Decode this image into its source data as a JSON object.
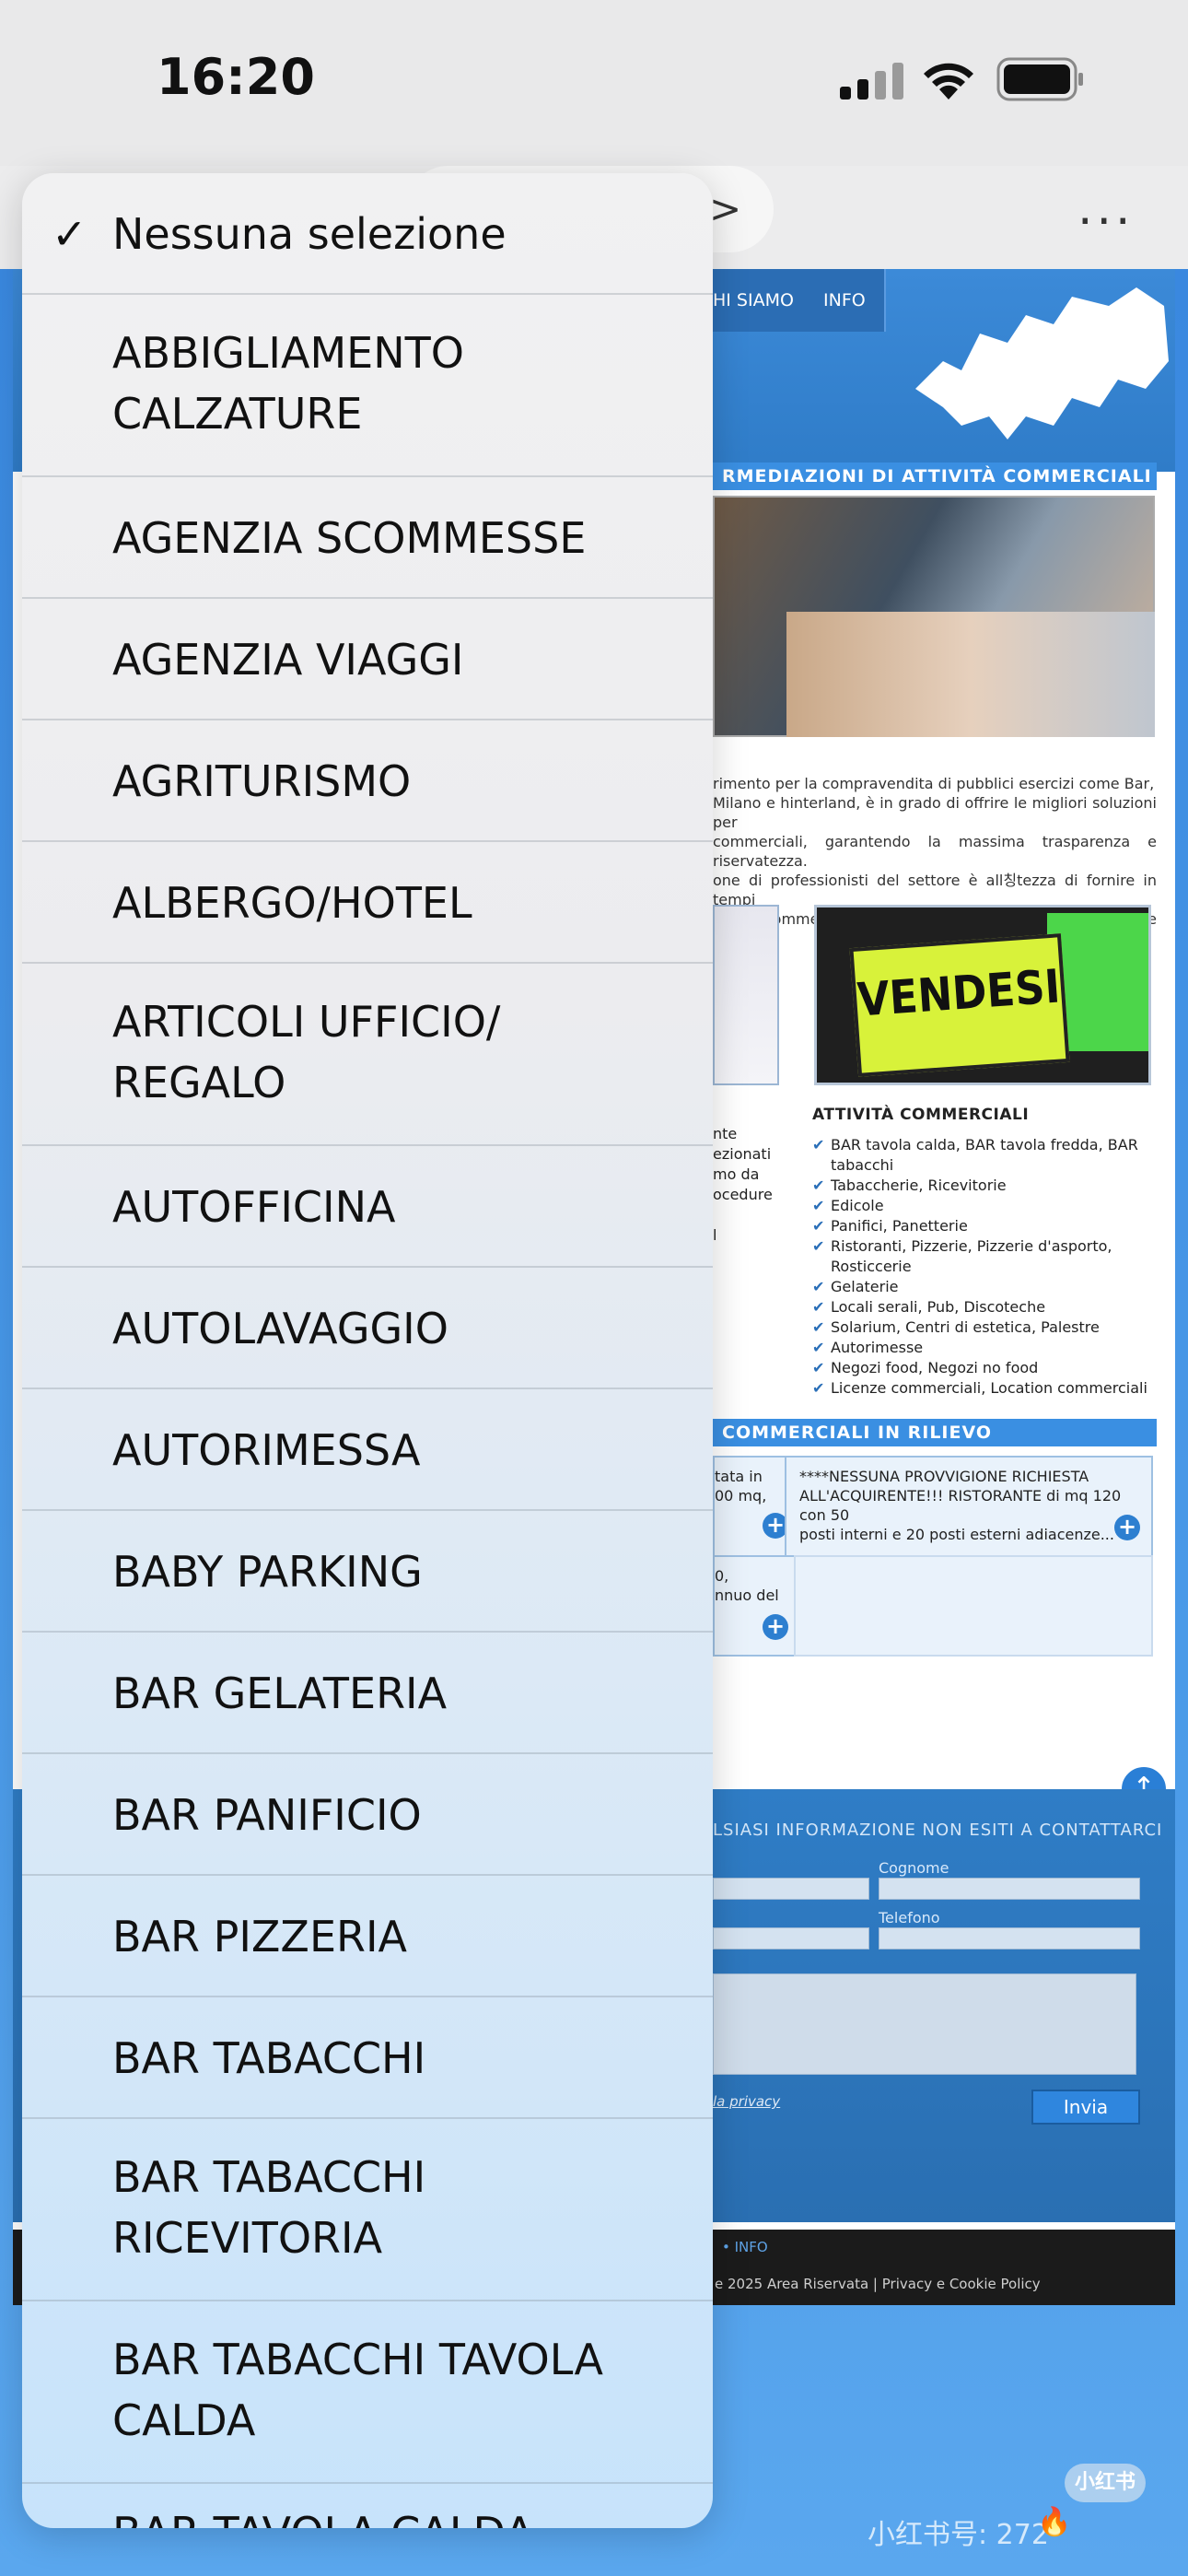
{
  "status_bar": {
    "time": "16:20"
  },
  "browser": {
    "url_chevron": ">",
    "more": "..."
  },
  "site": {
    "nav": [
      "HI SIAMO",
      "INFO"
    ],
    "section_title": "RMEDIAZIONI DI ATTIVITÀ COMMERCIALI",
    "intro_lines": [
      "rimento per la compravendita di pubblici esercizi come Bar,",
      "Milano e hinterland, è in grado di offrire le migliori soluzioni per",
      "commerciali, garantendo la massima trasparenza e riservatezza.",
      "one di professionisti del settore è all칭tezza di fornire in tempi",
      "ttività commerciali nella più totale sicurezza, chiarezza e privacy"
    ],
    "vendesi_sign": "VENDESI",
    "list_title": "ATTIVITÀ COMMERCIALI",
    "activities": [
      "BAR tavola calda, BAR tavola fredda, BAR tabacchi",
      "Tabaccherie, Ricevitorie",
      "Edicole",
      "Panifici, Panetterie",
      "Ristoranti, Pizzerie, Pizzerie d'asporto, Rosticcerie",
      "Gelaterie",
      "Locali serali, Pub, Discoteche",
      "Solarium, Centri di estetica, Palestre",
      "Autorimesse",
      "Negozi food, Negozi no food",
      "Licenze commerciali, Location commerciali"
    ],
    "left_fragments": [
      "nte",
      "ezionati",
      "mo da",
      "ocedure",
      "l"
    ],
    "featured_title": "COMMERCIALI IN RILIEVO",
    "featured_card_1": [
      "****NESSUNA PROVVIGIONE RICHIESTA",
      "ALL'ACQUIRENTE!!! RISTORANTE di mq 120 con 50",
      "posti interni e 20 posti esterni adiacenze..."
    ],
    "featured_left_1": [
      "tata in",
      "00 mq,"
    ],
    "featured_left_2": [
      "0,",
      "nnuo del"
    ],
    "contact_title": "LSIASI INFORMAZIONE NON ESITI A CONTATTARCI",
    "label_cognome": "Cognome",
    "label_telefono": "Telefono",
    "privacy_fragment": "la privacy",
    "send_button": "Invia",
    "footer_info": "• INFO",
    "footer_line": "e 2025     Area Riservata | Privacy e Cookie Policy"
  },
  "dropdown": {
    "selected_index": 0,
    "options": [
      "Nessuna selezione",
      "ABBIGLIAMENTO CALZATURE",
      "AGENZIA SCOMMESSE",
      "AGENZIA VIAGGI",
      "AGRITURISMO",
      "ALBERGO/HOTEL",
      "ARTICOLI UFFICIO/ REGALO",
      "AUTOFFICINA",
      "AUTOLAVAGGIO",
      "AUTORIMESSA",
      "BABY PARKING",
      "BAR GELATERIA",
      "BAR PANIFICIO",
      "BAR PIZZERIA",
      "BAR TABACCHI",
      "BAR TABACCHI RICEVITORIA",
      "BAR TABACCHI TAVOLA CALDA",
      "BAR TAVOLA CALDA"
    ],
    "option_lines": [
      [
        "Nessuna selezione"
      ],
      [
        "ABBIGLIAMENTO",
        "CALZATURE"
      ],
      [
        "AGENZIA SCOMMESSE"
      ],
      [
        "AGENZIA VIAGGI"
      ],
      [
        "AGRITURISMO"
      ],
      [
        "ALBERGO/HOTEL"
      ],
      [
        "ARTICOLI UFFICIO/",
        "REGALO"
      ],
      [
        "AUTOFFICINA"
      ],
      [
        "AUTOLAVAGGIO"
      ],
      [
        "AUTORIMESSA"
      ],
      [
        "BABY PARKING"
      ],
      [
        "BAR GELATERIA"
      ],
      [
        "BAR PANIFICIO"
      ],
      [
        "BAR PIZZERIA"
      ],
      [
        "BAR TABACCHI"
      ],
      [
        "BAR TABACCHI",
        "RICEVITORIA"
      ],
      [
        "BAR TABACCHI TAVOLA",
        "CALDA"
      ],
      [
        "BAR TAVOLA CALDA"
      ]
    ]
  },
  "watermark": {
    "badge": "小红书",
    "text": "小红书号: 272",
    "logo": "🔥"
  },
  "colors": {
    "accent": "#3a8fe2",
    "popover_top": "#f1f1f2",
    "popover_bottom": "#c7e3fb"
  }
}
